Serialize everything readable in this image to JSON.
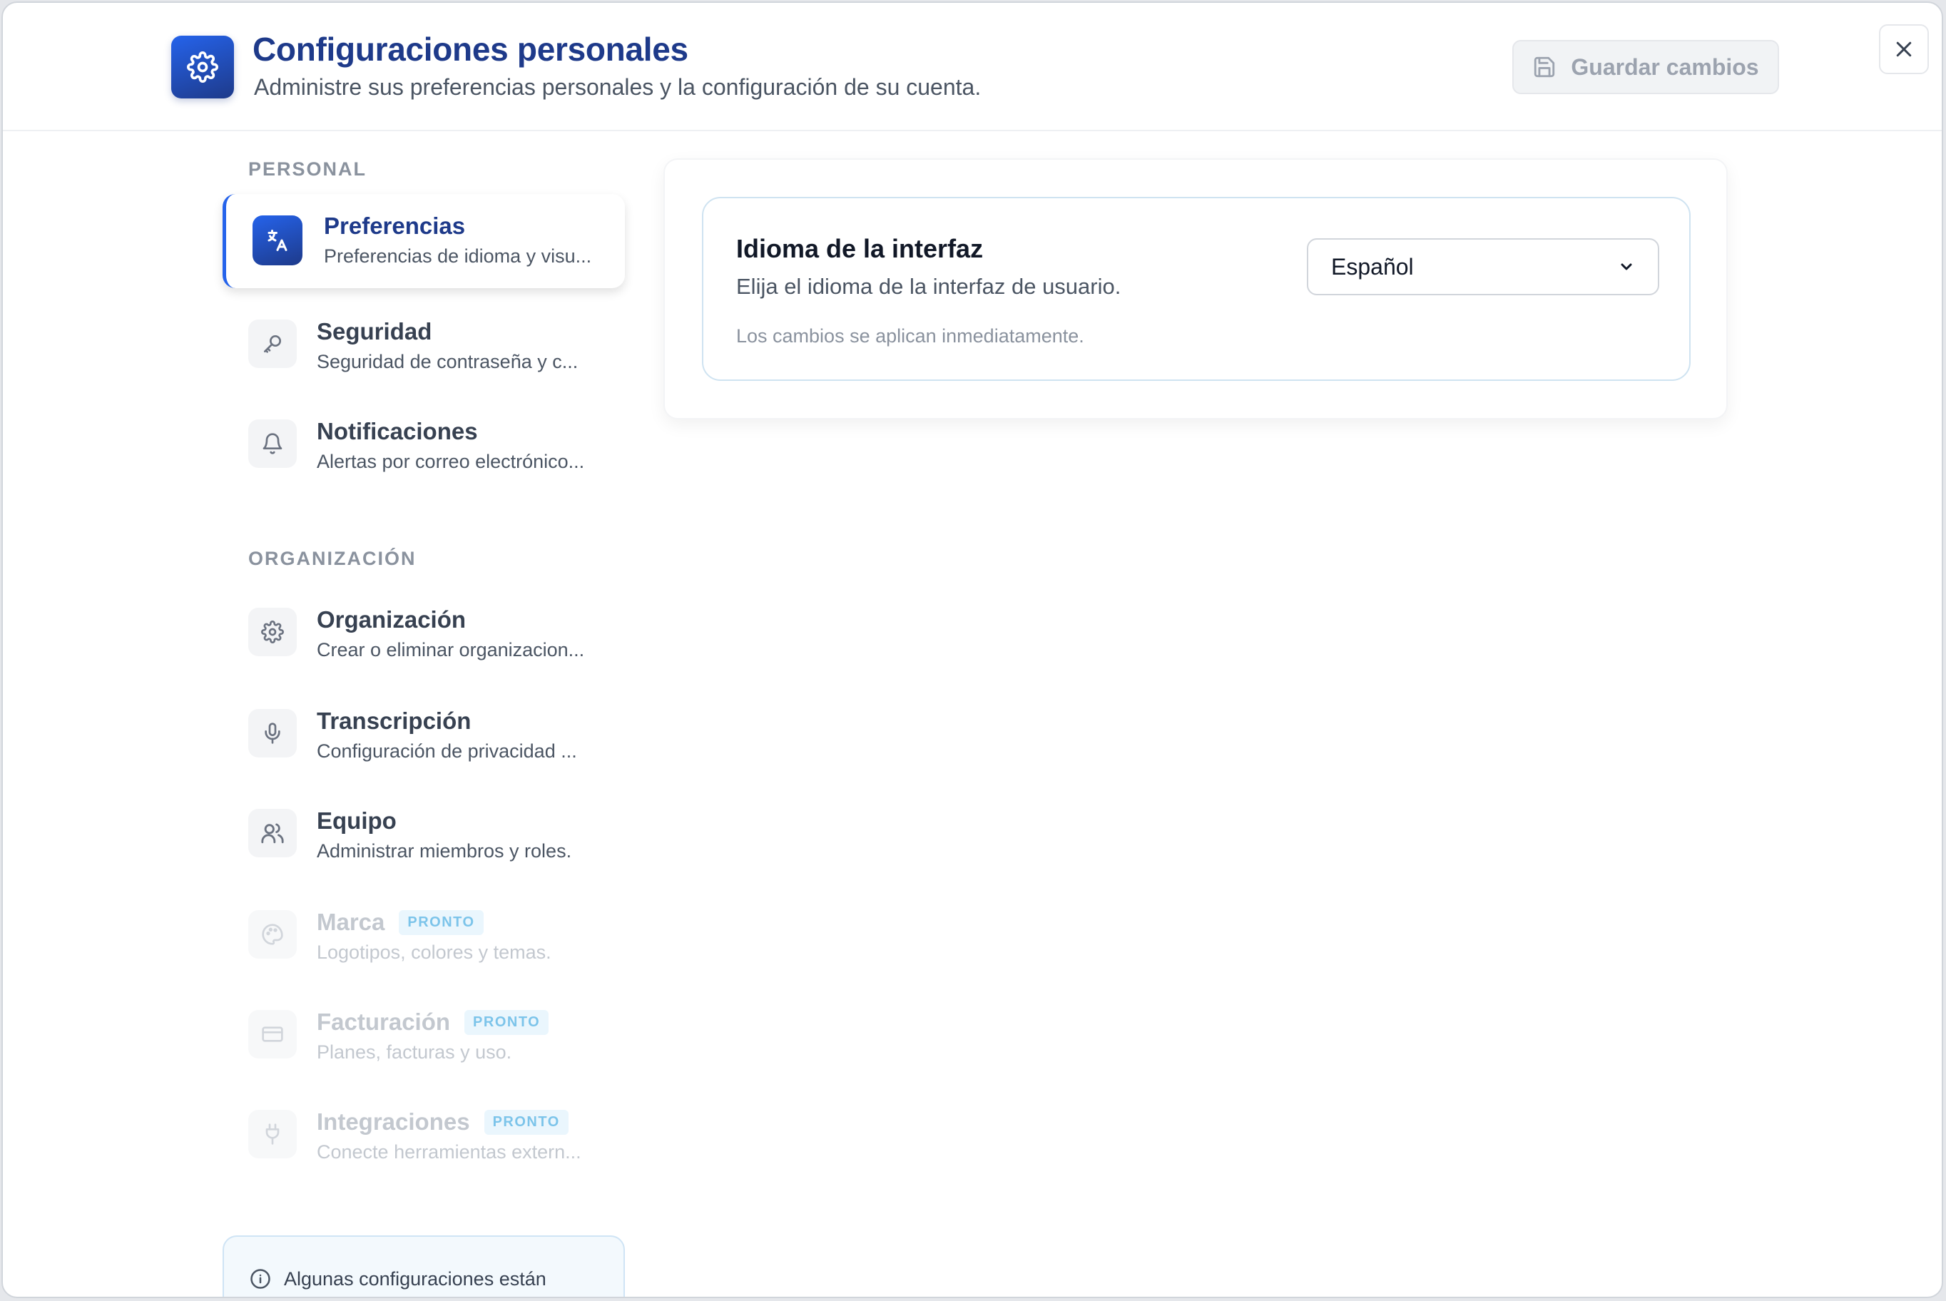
{
  "header": {
    "title": "Configuraciones personales",
    "subtitle": "Administre sus preferencias personales y la configuración de su cuenta.",
    "save_label": "Guardar cambios"
  },
  "sidebar": {
    "sections": [
      {
        "label": "PERSONAL",
        "items": [
          {
            "title": "Preferencias",
            "desc": "Preferencias de idioma y visu...",
            "icon": "translate-icon",
            "active": true
          },
          {
            "title": "Seguridad",
            "desc": "Seguridad de contraseña y c...",
            "icon": "key-icon"
          },
          {
            "title": "Notificaciones",
            "desc": "Alertas por correo electrónico...",
            "icon": "bell-icon"
          }
        ]
      },
      {
        "label": "ORGANIZACIÓN",
        "items": [
          {
            "title": "Organización",
            "desc": "Crear o eliminar organizacion...",
            "icon": "gear-icon"
          },
          {
            "title": "Transcripción",
            "desc": "Configuración de privacidad ...",
            "icon": "microphone-icon"
          },
          {
            "title": "Equipo",
            "desc": "Administrar miembros y roles.",
            "icon": "users-icon"
          },
          {
            "title": "Marca",
            "desc": "Logotipos, colores y temas.",
            "icon": "palette-icon",
            "badge": "PRONTO",
            "disabled": true
          },
          {
            "title": "Facturación",
            "desc": "Planes, facturas y uso.",
            "icon": "credit-card-icon",
            "badge": "PRONTO",
            "disabled": true
          },
          {
            "title": "Integraciones",
            "desc": "Conecte herramientas extern...",
            "icon": "plug-icon",
            "badge": "PRONTO",
            "disabled": true
          }
        ]
      }
    ],
    "info_text": "Algunas configuraciones están"
  },
  "content": {
    "setting_title": "Idioma de la interfaz",
    "setting_desc": "Elija el idioma de la interfaz de usuario.",
    "setting_note": "Los cambios se aplican inmediatamente.",
    "language_selected": "Español"
  },
  "colors": {
    "accent": "#1e3a8a",
    "accent_light": "#2563eb",
    "badge": "#7cc4ea"
  }
}
